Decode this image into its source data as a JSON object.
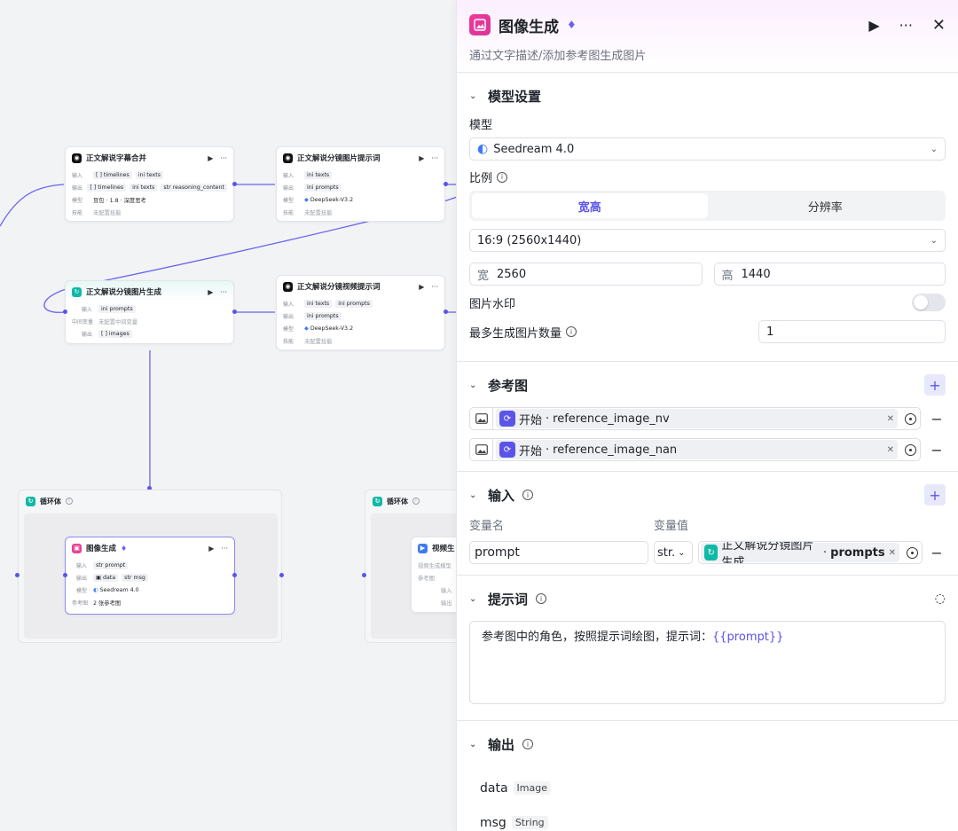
{
  "canvas": {
    "node_text_labels": {
      "input": "输入",
      "output": "输出",
      "model": "模型",
      "skills": "技能",
      "mid_var": "中间变量",
      "ref_image": "参考图",
      "video_model": "视频生成模型"
    },
    "nodes": {
      "merge": {
        "title": "正文解说字幕合并",
        "inputs": [
          "timelines",
          "texts"
        ],
        "outputs": [
          "timelines",
          "texts",
          "reasoning_content"
        ],
        "model": "豆包 · 1.8 · 深度思考",
        "skills": "未配置技能"
      },
      "img_prompt": {
        "title": "正文解说分镜图片提示词",
        "inputs": [
          "texts"
        ],
        "outputs": [
          "prompts"
        ],
        "model": "DeepSeek-V3.2",
        "skills": "未配置技能"
      },
      "img_gen": {
        "title": "正文解说分镜图片生成",
        "inputs": [
          "prompts"
        ],
        "mid": "未配置中间变量",
        "outputs": [
          "images"
        ]
      },
      "video_prompt": {
        "title": "正文解说分镜视频提示词",
        "inputs": [
          "texts",
          "prompts"
        ],
        "outputs": [
          "prompts"
        ],
        "model": "DeepSeek-V3.2",
        "skills": "未配置技能"
      },
      "image_node": {
        "title": "图像生成",
        "inputs": [
          "prompt"
        ],
        "outputs": [
          "data",
          "msg"
        ],
        "model": "Seedream 4.0",
        "ref": "2 张参考图"
      },
      "video_node": {
        "title": "视频生"
      }
    },
    "loops": [
      "循环体",
      "循环体"
    ]
  },
  "panel": {
    "title": "图像生成",
    "description": "通过文字描述/添加参考图生成图片",
    "model_section": {
      "title": "模型设置",
      "model_label": "模型",
      "model_value": "Seedream 4.0",
      "ratio_label": "比例",
      "seg_options": [
        "宽高",
        "分辨率"
      ],
      "ratio_value": "16:9 (2560x1440)",
      "width_prefix": "宽",
      "width_value": "2560",
      "height_prefix": "高",
      "height_value": "1440",
      "watermark_label": "图片水印",
      "max_count_label": "最多生成图片数量",
      "max_count_value": "1"
    },
    "ref_section": {
      "title": "参考图",
      "items": [
        {
          "source": "开始",
          "var": "reference_image_nv"
        },
        {
          "source": "开始",
          "var": "reference_image_nan"
        }
      ]
    },
    "input_section": {
      "title": "输入",
      "col_name": "变量名",
      "col_value": "变量值",
      "var_name": "prompt",
      "var_type": "str.",
      "var_source": "正文解说分镜图片生成",
      "var_field": "prompts"
    },
    "prompt_section": {
      "title": "提示词",
      "text": "参考图中的角色，按照提示词绘图，提示词：",
      "var": "{{prompt}}"
    },
    "output_section": {
      "title": "输出",
      "items": [
        {
          "name": "data",
          "type": "Image"
        },
        {
          "name": "msg",
          "type": "String"
        }
      ]
    }
  }
}
